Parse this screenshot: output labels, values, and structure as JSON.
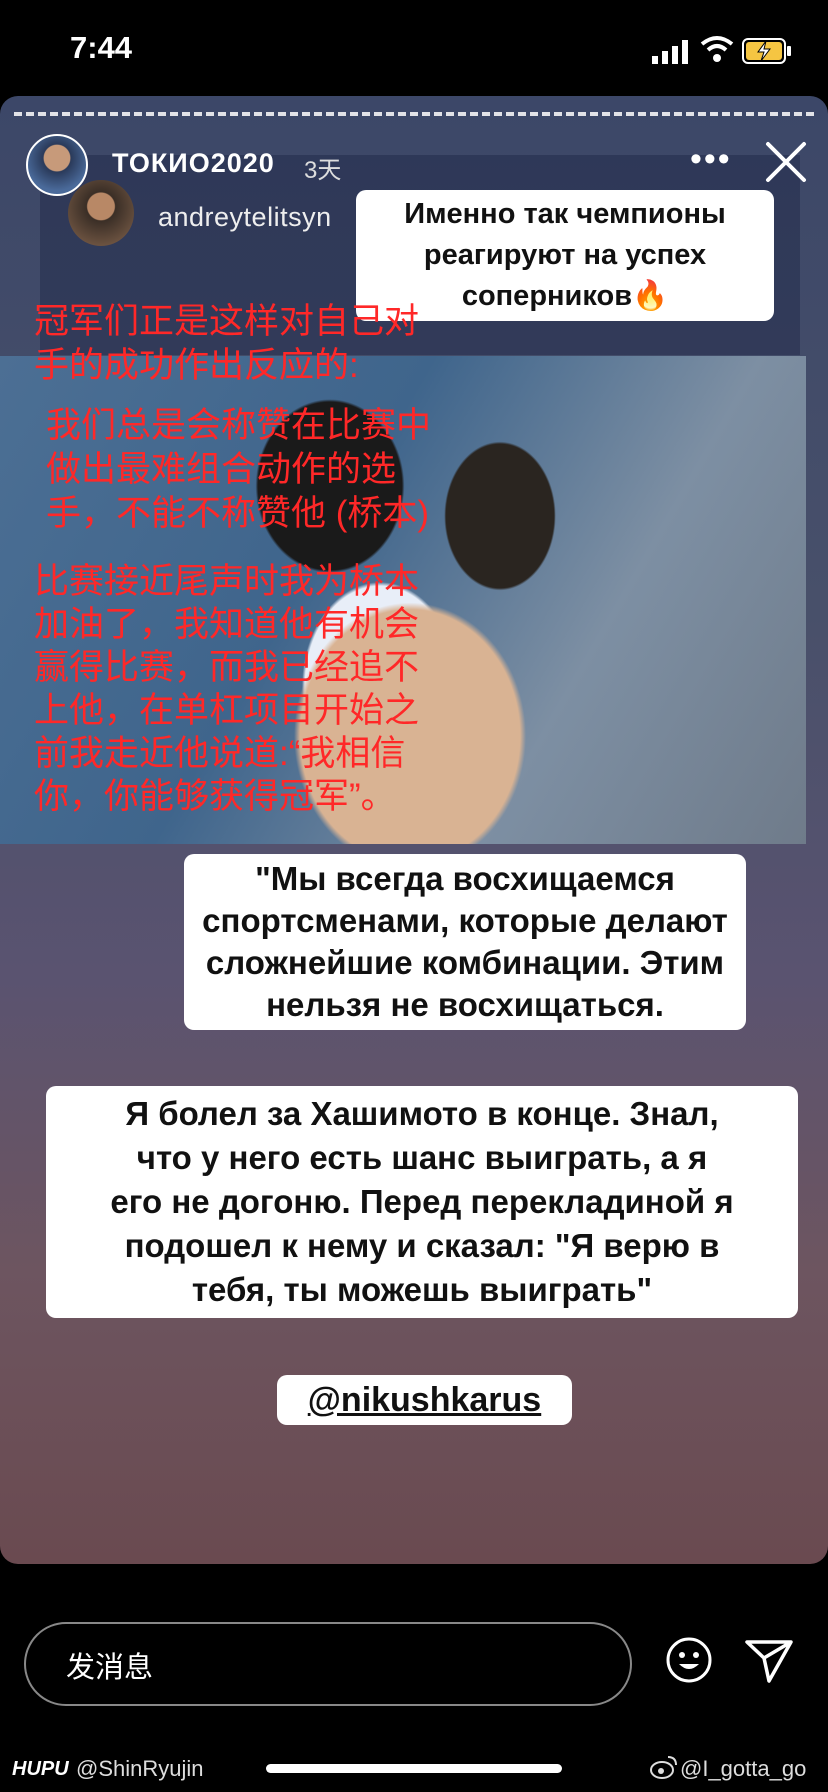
{
  "status_bar": {
    "time": "7:44"
  },
  "story": {
    "account_name": "ТОКИО2020",
    "time_ago": "3天",
    "more_label": "•••",
    "shared_account": "andreytelitsyn",
    "sticker_title": "Именно так чемпионы\nреагируют на успех\nсоперников🔥",
    "overlay_zh_1": "冠军们正是这样对自己对\n手的成功作出反应的:",
    "overlay_zh_2": "我们总是会称赞在比赛中\n做出最难组合动作的选\n手，不能不称赞他 (桥本)",
    "overlay_zh_3": "比赛接近尾声时我为桥本\n加油了，我知道他有机会\n赢得比赛，而我已经追不\n上他，在单杠项目开始之\n前我走近他说道:“我相信\n你，你能够获得冠军”。",
    "quote_1": "\"Мы всегда восхищаемся\nспортсменами, которые делают\nсложнейшие комбинации. Этим\nнельзя не восхищаться.",
    "quote_2": "Я болел за Хашимото в конце. Знал,\nчто у него есть шанс выиграть, а я\nего не догоню. Перед перекладиной я\nподошел к нему и сказал: \"Я верю в\nтебя, ты можешь выиграть\"",
    "mention": "@nikushkarus"
  },
  "reply": {
    "placeholder": "发消息"
  },
  "watermarks": {
    "hupu": "HUPU",
    "hupu_user": "@ShinRyujin",
    "weibo_user": "@I_gotta_go"
  },
  "colors": {
    "overlay_red": "#ff2828",
    "sticker_bg": "#ffffff"
  }
}
